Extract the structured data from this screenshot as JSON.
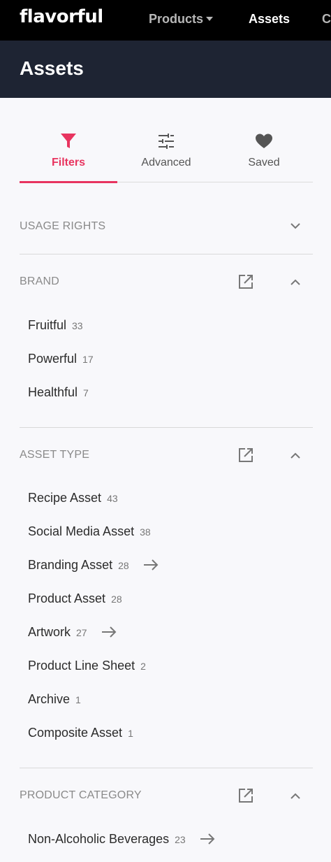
{
  "nav": {
    "logo": "flavorful",
    "products": "Products",
    "assets": "Assets",
    "more": "C"
  },
  "header": {
    "title": "Assets"
  },
  "tabs": [
    {
      "label": "Filters",
      "icon": "funnel-icon",
      "active": true
    },
    {
      "label": "Advanced",
      "icon": "sliders-icon",
      "active": false
    },
    {
      "label": "Saved",
      "icon": "heart-icon",
      "active": false
    }
  ],
  "sections": {
    "usage_rights": {
      "title": "USAGE RIGHTS"
    },
    "brand": {
      "title": "BRAND",
      "items": [
        {
          "label": "Fruitful",
          "count": "33"
        },
        {
          "label": "Powerful",
          "count": "17"
        },
        {
          "label": "Healthful",
          "count": "7"
        }
      ]
    },
    "asset_type": {
      "title": "ASSET TYPE",
      "items": [
        {
          "label": "Recipe Asset",
          "count": "43"
        },
        {
          "label": "Social Media Asset",
          "count": "38"
        },
        {
          "label": "Branding Asset",
          "count": "28"
        },
        {
          "label": "Product Asset",
          "count": "28"
        },
        {
          "label": "Artwork",
          "count": "27"
        },
        {
          "label": "Product Line Sheet",
          "count": "2"
        },
        {
          "label": "Archive",
          "count": "1"
        },
        {
          "label": "Composite Asset",
          "count": "1"
        }
      ]
    },
    "product_category": {
      "title": "PRODUCT CATEGORY",
      "items": [
        {
          "label": "Non-Alcoholic Beverages",
          "count": "23"
        }
      ]
    }
  },
  "colors": {
    "accent": "#e8345f",
    "nav_bg": "#000000",
    "header_bg": "#1e2433",
    "page_bg": "#f8f8fb"
  }
}
